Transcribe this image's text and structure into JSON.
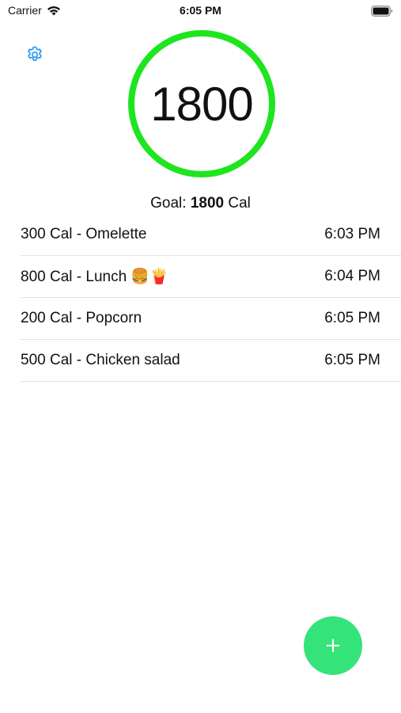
{
  "status_bar": {
    "carrier": "Carrier",
    "time": "6:05 PM",
    "wifi_icon": "wifi-icon",
    "battery_icon": "battery-icon"
  },
  "settings": {
    "icon": "gear-icon",
    "color": "#2196f3"
  },
  "ring": {
    "value": "1800",
    "color": "#1ee51e"
  },
  "goal": {
    "prefix": "Goal: ",
    "value": "1800",
    "suffix": " Cal"
  },
  "entries": [
    {
      "text": "300 Cal - Omelette",
      "time": "6:03 PM"
    },
    {
      "text": "800 Cal - Lunch 🍔🍟",
      "time": "6:04 PM"
    },
    {
      "text": "200 Cal - Popcorn",
      "time": "6:05 PM"
    },
    {
      "text": "500 Cal - Chicken salad",
      "time": "6:05 PM"
    }
  ],
  "add_button": {
    "label": "+",
    "color": "#34e47a"
  }
}
